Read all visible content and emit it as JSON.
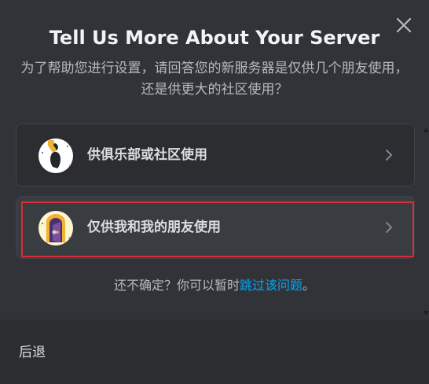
{
  "modal": {
    "title": "Tell Us More About Your Server",
    "subtitle": "为了帮助您进行设置，请回答您的新服务器是仅供几个朋友使用，还是供更大的社区使用？"
  },
  "options": [
    {
      "label": "供俱乐部或社区使用",
      "icon": "club-community-icon"
    },
    {
      "label": "仅供我和我的朋友使用",
      "icon": "friends-door-icon"
    }
  ],
  "hint": {
    "prefix": "还不确定？你可以暂时",
    "link": "跳过该问题",
    "suffix": "。"
  },
  "footer": {
    "back_label": "后退"
  },
  "colors": {
    "background": "#313338",
    "footer": "#2b2d31",
    "link": "#00a8fc",
    "focus_ring": "#da2c38"
  }
}
